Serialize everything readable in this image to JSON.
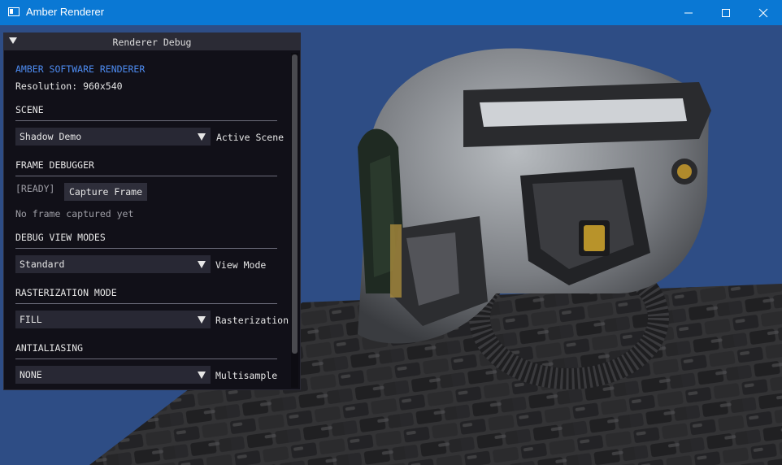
{
  "window": {
    "title": "Amber Renderer",
    "controls": [
      "minimize",
      "maximize",
      "close"
    ]
  },
  "panel": {
    "title": "Renderer Debug",
    "app_name": "AMBER SOFTWARE RENDERER",
    "resolution": "Resolution: 960x540",
    "scene": {
      "header": "SCENE",
      "value": "Shadow Demo",
      "label": "Active Scene"
    },
    "frame_debugger": {
      "header": "FRAME DEBUGGER",
      "status": "[READY]",
      "capture_label": "Capture Frame",
      "message": "No frame captured yet"
    },
    "debug_view": {
      "header": "DEBUG VIEW MODES",
      "value": "Standard",
      "label": "View Mode"
    },
    "rasterization": {
      "header": "RASTERIZATION MODE",
      "value": "FILL",
      "label": "Rasterization"
    },
    "antialiasing": {
      "header": "ANTIALIASING",
      "value": "NONE",
      "label": "Multisample"
    }
  },
  "colors": {
    "titlebar": "#0a78d4",
    "viewport_background": "#2e4d85",
    "panel_background": "#111018",
    "accent_text": "#4d8bf0"
  }
}
